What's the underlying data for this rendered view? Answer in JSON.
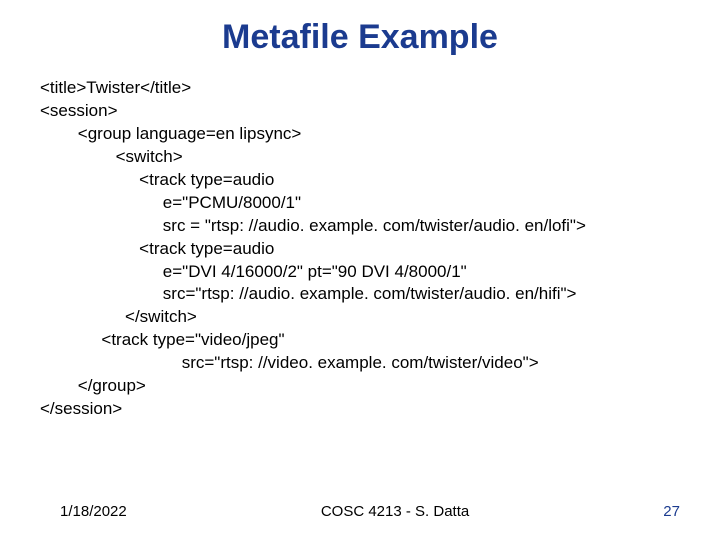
{
  "title": "Metafile Example",
  "code_lines": [
    "<title>Twister</title>",
    "<session>",
    "        <group language=en lipsync>",
    "                <switch>",
    "                     <track type=audio",
    "                          e=\"PCMU/8000/1\"",
    "                          src = \"rtsp: //audio. example. com/twister/audio. en/lofi\">",
    "                     <track type=audio",
    "                          e=\"DVI 4/16000/2\" pt=\"90 DVI 4/8000/1\"",
    "                          src=\"rtsp: //audio. example. com/twister/audio. en/hifi\">",
    "                  </switch>",
    "             <track type=\"video/jpeg\"",
    "                              src=\"rtsp: //video. example. com/twister/video\">",
    "        </group>",
    "</session>"
  ],
  "footer": {
    "date": "1/18/2022",
    "center": "COSC 4213 - S. Datta",
    "page": "27"
  }
}
